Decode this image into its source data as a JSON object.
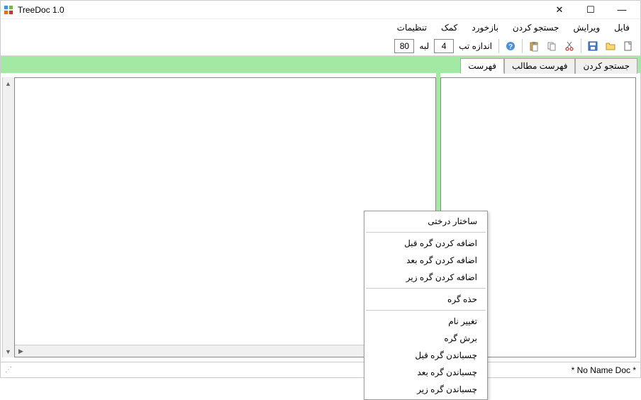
{
  "title": "TreeDoc 1.0",
  "menu": [
    "فایل",
    "ویرایش",
    "جستجو کردن",
    "بازخورد",
    "کمک",
    "تنظیمات"
  ],
  "toolbar": {
    "tabsize_label": "اندازه تب",
    "tabsize_value": "4",
    "edge_label": "لبه",
    "edge_value": "80"
  },
  "tabs": [
    "جستجو کردن",
    "فهرست مطالب",
    "فهرست"
  ],
  "active_tab": 2,
  "context": [
    {
      "t": "item",
      "label": "ساختار درختی"
    },
    {
      "t": "sep"
    },
    {
      "t": "item",
      "label": "اضافه کردن گره قبل"
    },
    {
      "t": "item",
      "label": "اضافه کردن گره بعد"
    },
    {
      "t": "item",
      "label": "اضافه کردن گره زیر"
    },
    {
      "t": "sep"
    },
    {
      "t": "item",
      "label": "حذه گره"
    },
    {
      "t": "sep"
    },
    {
      "t": "item",
      "label": "تغییر نام"
    },
    {
      "t": "item",
      "label": "برش گره"
    },
    {
      "t": "item",
      "label": "چسباندن گره قبل"
    },
    {
      "t": "item",
      "label": "چسباندن گره بعد"
    },
    {
      "t": "item",
      "label": "چسباندن گره زیر"
    }
  ],
  "status": "* No Name Doc *"
}
